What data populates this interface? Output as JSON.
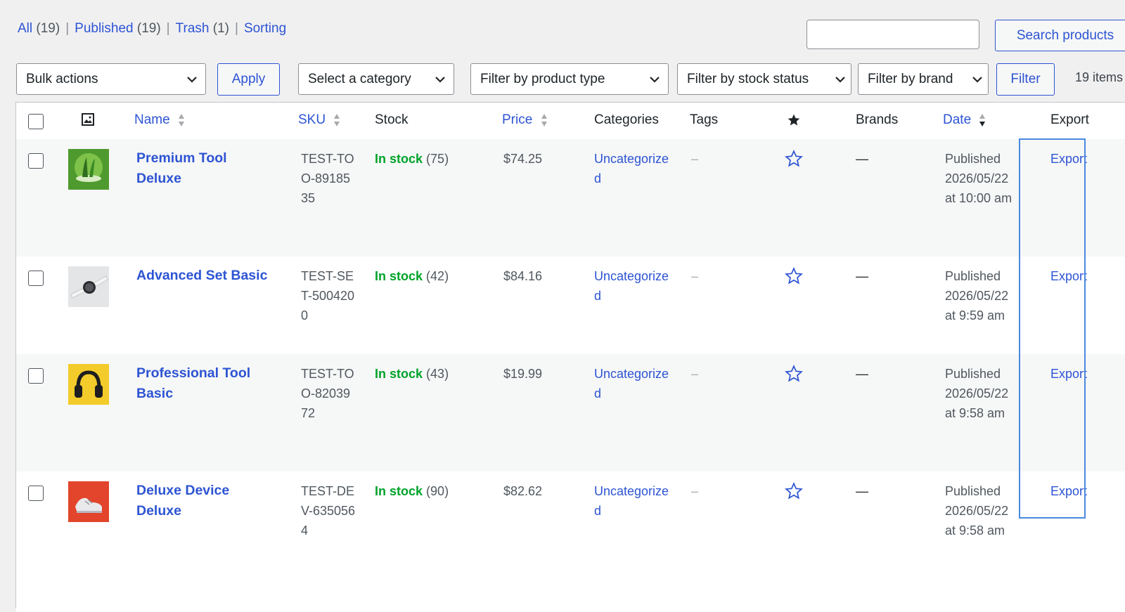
{
  "status_links": [
    {
      "label": "All",
      "count": "(19)"
    },
    {
      "label": "Published",
      "count": "(19)"
    },
    {
      "label": "Trash",
      "count": "(1)"
    },
    {
      "label": "Sorting",
      "count": ""
    }
  ],
  "search": {
    "button_label": "Search products",
    "value": ""
  },
  "filters": {
    "bulk_actions": "Bulk actions",
    "apply": "Apply",
    "category": "Select a category",
    "product_type": "Filter by product type",
    "stock_status": "Filter by stock status",
    "brand": "Filter by brand",
    "filter_button": "Filter",
    "items_count": "19 items"
  },
  "columns": {
    "name": "Name",
    "sku": "SKU",
    "stock": "Stock",
    "price": "Price",
    "categories": "Categories",
    "tags": "Tags",
    "brands": "Brands",
    "date": "Date",
    "export": "Export"
  },
  "rows": [
    {
      "name": "Premium Tool Deluxe",
      "sku": "TEST-TOO-8918535",
      "stock_label": "In stock",
      "stock_qty": "(75)",
      "price": "$74.25",
      "category": "Uncategorized",
      "tags": "–",
      "brands": "—",
      "date_status": "Published",
      "date": "2026/05/22",
      "time": "at 10:00 am",
      "export": "Export",
      "thumb": "green-plant"
    },
    {
      "name": "Advanced Set Basic",
      "sku": "TEST-SET-5004200",
      "stock_label": "In stock",
      "stock_qty": "(42)",
      "price": "$84.16",
      "category": "Uncategorized",
      "tags": "–",
      "brands": "—",
      "date_status": "Published",
      "date": "2026/05/22",
      "time": "at 9:59 am",
      "export": "Export",
      "thumb": "watch"
    },
    {
      "name": "Professional Tool Basic",
      "sku": "TEST-TOO-8203972",
      "stock_label": "In stock",
      "stock_qty": "(43)",
      "price": "$19.99",
      "category": "Uncategorized",
      "tags": "–",
      "brands": "—",
      "date_status": "Published",
      "date": "2026/05/22",
      "time": "at 9:58 am",
      "export": "Export",
      "thumb": "headphones"
    },
    {
      "name": "Deluxe Device Deluxe",
      "sku": "TEST-DEV-6350564",
      "stock_label": "In stock",
      "stock_qty": "(90)",
      "price": "$82.62",
      "category": "Uncategorized",
      "tags": "–",
      "brands": "—",
      "date_status": "Published",
      "date": "2026/05/22",
      "time": "at 9:58 am",
      "export": "Export",
      "thumb": "sneaker"
    }
  ],
  "colors": {
    "link": "#2d54d3",
    "in_stock": "#00a32a",
    "highlight": "#4a88e0"
  }
}
